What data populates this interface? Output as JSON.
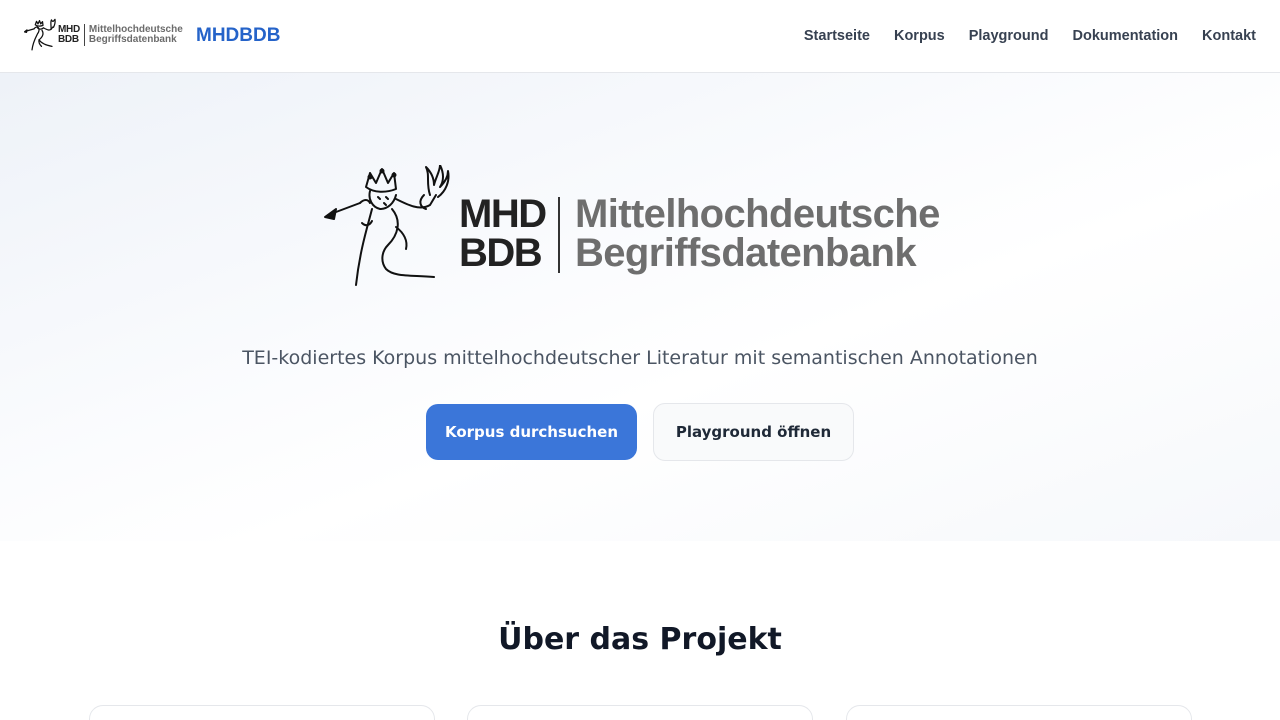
{
  "header": {
    "logo": {
      "mark_line1": "MHD",
      "mark_line2": "BDB",
      "words_line1": "Mittelhochdeutsche",
      "words_line2": "Begriffsdatenbank"
    },
    "brand_name": "MHDBDB",
    "nav": [
      {
        "label": "Startseite"
      },
      {
        "label": "Korpus"
      },
      {
        "label": "Playground"
      },
      {
        "label": "Dokumentation"
      },
      {
        "label": "Kontakt"
      }
    ]
  },
  "hero": {
    "logo": {
      "mark_line1": "MHD",
      "mark_line2": "BDB",
      "words_line1": "Mittelhochdeutsche",
      "words_line2": "Begriffsdatenbank"
    },
    "tagline": "TEI-kodiertes Korpus mittelhochdeutscher Literatur mit semantischen Annotationen",
    "primary_button": "Korpus durchsuchen",
    "secondary_button": "Playground öffnen"
  },
  "about": {
    "title": "Über das Projekt"
  },
  "colors": {
    "brand": "#2563c9",
    "primary_button": "#3b76d9",
    "logo_dark": "#222222",
    "logo_grey": "#6e6e6e"
  }
}
